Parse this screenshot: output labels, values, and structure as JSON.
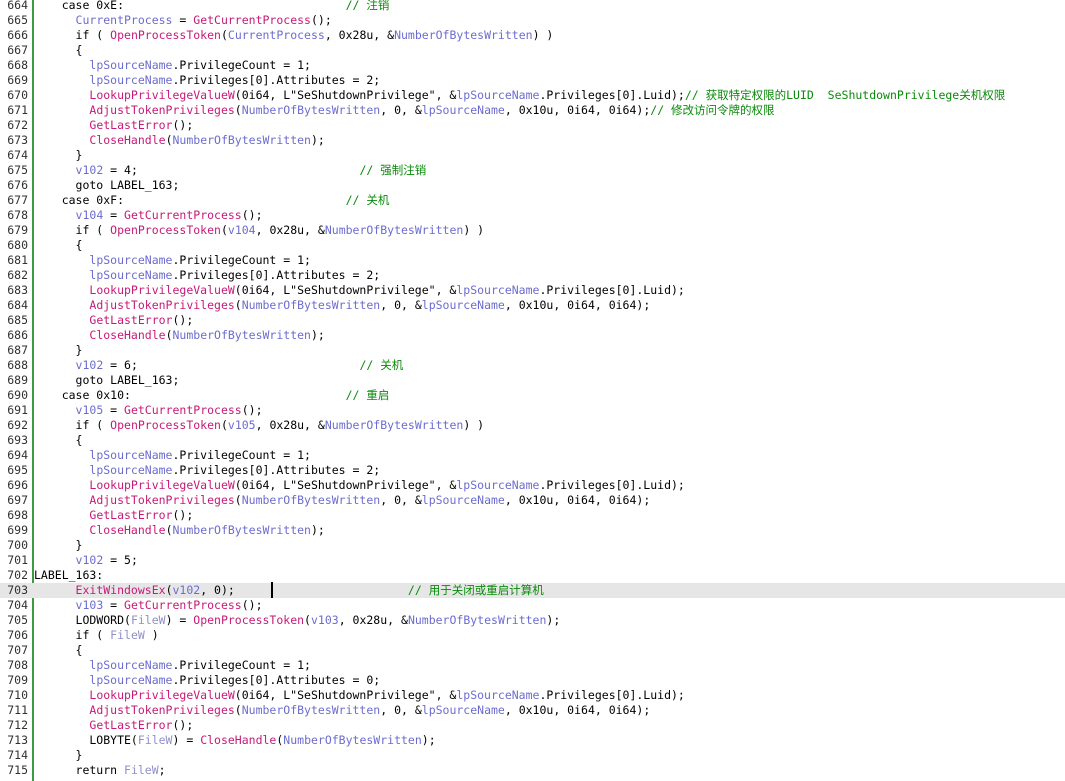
{
  "editor": {
    "current_line": 703,
    "lines": [
      {
        "no": "664",
        "segs": [
          [
            "    case 0xE:                                ",
            ""
          ],
          [
            "// 注销",
            "cm"
          ]
        ]
      },
      {
        "no": "665",
        "segs": [
          [
            "      ",
            ""
          ],
          [
            "CurrentProcess",
            "lvar"
          ],
          [
            " = ",
            ""
          ],
          [
            "GetCurrentProcess",
            "fn"
          ],
          [
            "();",
            ""
          ]
        ]
      },
      {
        "no": "666",
        "segs": [
          [
            "      if ( ",
            ""
          ],
          [
            "OpenProcessToken",
            "fn"
          ],
          [
            "(",
            ""
          ],
          [
            "CurrentProcess",
            "lvar"
          ],
          [
            ", 0x28u, &",
            ""
          ],
          [
            "NumberOfBytesWritten",
            "lvar"
          ],
          [
            ") )",
            ""
          ]
        ]
      },
      {
        "no": "667",
        "segs": [
          [
            "      {",
            ""
          ]
        ]
      },
      {
        "no": "668",
        "segs": [
          [
            "        ",
            ""
          ],
          [
            "lpSourceName",
            "lvar"
          ],
          [
            ".PrivilegeCount = 1;",
            ""
          ]
        ]
      },
      {
        "no": "669",
        "segs": [
          [
            "        ",
            ""
          ],
          [
            "lpSourceName",
            "lvar"
          ],
          [
            ".Privileges[0].Attributes = 2;",
            ""
          ]
        ]
      },
      {
        "no": "670",
        "segs": [
          [
            "        ",
            ""
          ],
          [
            "LookupPrivilegeValueW",
            "fn"
          ],
          [
            "(0i64, L\"SeShutdownPrivilege\", &",
            ""
          ],
          [
            "lpSourceName",
            "lvar"
          ],
          [
            ".Privileges[0].Luid);",
            ""
          ],
          [
            "// 获取特定权限的LUID  SeShutdownPrivilege关机权限",
            "cm"
          ]
        ]
      },
      {
        "no": "671",
        "segs": [
          [
            "        ",
            ""
          ],
          [
            "AdjustTokenPrivileges",
            "fn"
          ],
          [
            "(",
            ""
          ],
          [
            "NumberOfBytesWritten",
            "lvar"
          ],
          [
            ", 0, &",
            ""
          ],
          [
            "lpSourceName",
            "lvar"
          ],
          [
            ", 0x10u, 0i64, 0i64);",
            ""
          ],
          [
            "// 修改访问令牌的权限",
            "cm"
          ]
        ]
      },
      {
        "no": "672",
        "segs": [
          [
            "        ",
            ""
          ],
          [
            "GetLastError",
            "fn"
          ],
          [
            "();",
            ""
          ]
        ]
      },
      {
        "no": "673",
        "segs": [
          [
            "        ",
            ""
          ],
          [
            "CloseHandle",
            "fn"
          ],
          [
            "(",
            ""
          ],
          [
            "NumberOfBytesWritten",
            "lvar"
          ],
          [
            ");",
            ""
          ]
        ]
      },
      {
        "no": "674",
        "segs": [
          [
            "      }",
            ""
          ]
        ]
      },
      {
        "no": "675",
        "segs": [
          [
            "      ",
            ""
          ],
          [
            "v102",
            "lvar"
          ],
          [
            " = 4;                                ",
            ""
          ],
          [
            "// 强制注销",
            "cm"
          ]
        ]
      },
      {
        "no": "676",
        "segs": [
          [
            "      goto LABEL_163;",
            ""
          ]
        ]
      },
      {
        "no": "677",
        "segs": [
          [
            "    case 0xF:                                ",
            ""
          ],
          [
            "// 关机",
            "cm"
          ]
        ]
      },
      {
        "no": "678",
        "segs": [
          [
            "      ",
            ""
          ],
          [
            "v104",
            "lvar"
          ],
          [
            " = ",
            ""
          ],
          [
            "GetCurrentProcess",
            "fn"
          ],
          [
            "();",
            ""
          ]
        ]
      },
      {
        "no": "679",
        "segs": [
          [
            "      if ( ",
            ""
          ],
          [
            "OpenProcessToken",
            "fn"
          ],
          [
            "(",
            ""
          ],
          [
            "v104",
            "lvar"
          ],
          [
            ", 0x28u, &",
            ""
          ],
          [
            "NumberOfBytesWritten",
            "lvar"
          ],
          [
            ") )",
            ""
          ]
        ]
      },
      {
        "no": "680",
        "segs": [
          [
            "      {",
            ""
          ]
        ]
      },
      {
        "no": "681",
        "segs": [
          [
            "        ",
            ""
          ],
          [
            "lpSourceName",
            "lvar"
          ],
          [
            ".PrivilegeCount = 1;",
            ""
          ]
        ]
      },
      {
        "no": "682",
        "segs": [
          [
            "        ",
            ""
          ],
          [
            "lpSourceName",
            "lvar"
          ],
          [
            ".Privileges[0].Attributes = 2;",
            ""
          ]
        ]
      },
      {
        "no": "683",
        "segs": [
          [
            "        ",
            ""
          ],
          [
            "LookupPrivilegeValueW",
            "fn"
          ],
          [
            "(0i64, L\"SeShutdownPrivilege\", &",
            ""
          ],
          [
            "lpSourceName",
            "lvar"
          ],
          [
            ".Privileges[0].Luid);",
            ""
          ]
        ]
      },
      {
        "no": "684",
        "segs": [
          [
            "        ",
            ""
          ],
          [
            "AdjustTokenPrivileges",
            "fn"
          ],
          [
            "(",
            ""
          ],
          [
            "NumberOfBytesWritten",
            "lvar"
          ],
          [
            ", 0, &",
            ""
          ],
          [
            "lpSourceName",
            "lvar"
          ],
          [
            ", 0x10u, 0i64, 0i64);",
            ""
          ]
        ]
      },
      {
        "no": "685",
        "segs": [
          [
            "        ",
            ""
          ],
          [
            "GetLastError",
            "fn"
          ],
          [
            "();",
            ""
          ]
        ]
      },
      {
        "no": "686",
        "segs": [
          [
            "        ",
            ""
          ],
          [
            "CloseHandle",
            "fn"
          ],
          [
            "(",
            ""
          ],
          [
            "NumberOfBytesWritten",
            "lvar"
          ],
          [
            ");",
            ""
          ]
        ]
      },
      {
        "no": "687",
        "segs": [
          [
            "      }",
            ""
          ]
        ]
      },
      {
        "no": "688",
        "segs": [
          [
            "      ",
            ""
          ],
          [
            "v102",
            "lvar"
          ],
          [
            " = 6;                                ",
            ""
          ],
          [
            "// 关机",
            "cm"
          ]
        ]
      },
      {
        "no": "689",
        "segs": [
          [
            "      goto LABEL_163;",
            ""
          ]
        ]
      },
      {
        "no": "690",
        "segs": [
          [
            "    case 0x10:                               ",
            ""
          ],
          [
            "// 重启",
            "cm"
          ]
        ]
      },
      {
        "no": "691",
        "segs": [
          [
            "      ",
            ""
          ],
          [
            "v105",
            "lvar"
          ],
          [
            " = ",
            ""
          ],
          [
            "GetCurrentProcess",
            "fn"
          ],
          [
            "();",
            ""
          ]
        ]
      },
      {
        "no": "692",
        "segs": [
          [
            "      if ( ",
            ""
          ],
          [
            "OpenProcessToken",
            "fn"
          ],
          [
            "(",
            ""
          ],
          [
            "v105",
            "lvar"
          ],
          [
            ", 0x28u, &",
            ""
          ],
          [
            "NumberOfBytesWritten",
            "lvar"
          ],
          [
            ") )",
            ""
          ]
        ]
      },
      {
        "no": "693",
        "segs": [
          [
            "      {",
            ""
          ]
        ]
      },
      {
        "no": "694",
        "segs": [
          [
            "        ",
            ""
          ],
          [
            "lpSourceName",
            "lvar"
          ],
          [
            ".PrivilegeCount = 1;",
            ""
          ]
        ]
      },
      {
        "no": "695",
        "segs": [
          [
            "        ",
            ""
          ],
          [
            "lpSourceName",
            "lvar"
          ],
          [
            ".Privileges[0].Attributes = 2;",
            ""
          ]
        ]
      },
      {
        "no": "696",
        "segs": [
          [
            "        ",
            ""
          ],
          [
            "LookupPrivilegeValueW",
            "fn"
          ],
          [
            "(0i64, L\"SeShutdownPrivilege\", &",
            ""
          ],
          [
            "lpSourceName",
            "lvar"
          ],
          [
            ".Privileges[0].Luid);",
            ""
          ]
        ]
      },
      {
        "no": "697",
        "segs": [
          [
            "        ",
            ""
          ],
          [
            "AdjustTokenPrivileges",
            "fn"
          ],
          [
            "(",
            ""
          ],
          [
            "NumberOfBytesWritten",
            "lvar"
          ],
          [
            ", 0, &",
            ""
          ],
          [
            "lpSourceName",
            "lvar"
          ],
          [
            ", 0x10u, 0i64, 0i64);",
            ""
          ]
        ]
      },
      {
        "no": "698",
        "segs": [
          [
            "        ",
            ""
          ],
          [
            "GetLastError",
            "fn"
          ],
          [
            "();",
            ""
          ]
        ]
      },
      {
        "no": "699",
        "segs": [
          [
            "        ",
            ""
          ],
          [
            "CloseHandle",
            "fn"
          ],
          [
            "(",
            ""
          ],
          [
            "NumberOfBytesWritten",
            "lvar"
          ],
          [
            ");",
            ""
          ]
        ]
      },
      {
        "no": "700",
        "segs": [
          [
            "      }",
            ""
          ]
        ]
      },
      {
        "no": "701",
        "segs": [
          [
            "      ",
            ""
          ],
          [
            "v102",
            "lvar"
          ],
          [
            " = 5;",
            ""
          ]
        ]
      },
      {
        "no": "702",
        "segs": [
          [
            "LABEL_163:",
            ""
          ]
        ]
      },
      {
        "no": "703",
        "segs": [
          [
            "      ",
            ""
          ],
          [
            "ExitWindowsEx",
            "fn"
          ],
          [
            "(",
            ""
          ],
          [
            "v102",
            "lvar"
          ],
          [
            ", 0);                         ",
            ""
          ],
          [
            "// 用于关闭或重启计算机",
            "cm"
          ]
        ]
      },
      {
        "no": "704",
        "segs": [
          [
            "      ",
            ""
          ],
          [
            "v103",
            "lvar"
          ],
          [
            " = ",
            ""
          ],
          [
            "GetCurrentProcess",
            "fn"
          ],
          [
            "();",
            ""
          ]
        ]
      },
      {
        "no": "705",
        "segs": [
          [
            "      LODWORD(",
            ""
          ],
          [
            "FileW",
            "gvar"
          ],
          [
            ") = ",
            ""
          ],
          [
            "OpenProcessToken",
            "fn"
          ],
          [
            "(",
            ""
          ],
          [
            "v103",
            "lvar"
          ],
          [
            ", 0x28u, &",
            ""
          ],
          [
            "NumberOfBytesWritten",
            "lvar"
          ],
          [
            ");",
            ""
          ]
        ]
      },
      {
        "no": "706",
        "segs": [
          [
            "      if ( ",
            ""
          ],
          [
            "FileW",
            "gvar"
          ],
          [
            " )",
            ""
          ]
        ]
      },
      {
        "no": "707",
        "segs": [
          [
            "      {",
            ""
          ]
        ]
      },
      {
        "no": "708",
        "segs": [
          [
            "        ",
            ""
          ],
          [
            "lpSourceName",
            "lvar"
          ],
          [
            ".PrivilegeCount = 1;",
            ""
          ]
        ]
      },
      {
        "no": "709",
        "segs": [
          [
            "        ",
            ""
          ],
          [
            "lpSourceName",
            "lvar"
          ],
          [
            ".Privileges[0].Attributes = 0;",
            ""
          ]
        ]
      },
      {
        "no": "710",
        "segs": [
          [
            "        ",
            ""
          ],
          [
            "LookupPrivilegeValueW",
            "fn"
          ],
          [
            "(0i64, L\"SeShutdownPrivilege\", &",
            ""
          ],
          [
            "lpSourceName",
            "lvar"
          ],
          [
            ".Privileges[0].Luid);",
            ""
          ]
        ]
      },
      {
        "no": "711",
        "segs": [
          [
            "        ",
            ""
          ],
          [
            "AdjustTokenPrivileges",
            "fn"
          ],
          [
            "(",
            ""
          ],
          [
            "NumberOfBytesWritten",
            "lvar"
          ],
          [
            ", 0, &",
            ""
          ],
          [
            "lpSourceName",
            "lvar"
          ],
          [
            ", 0x10u, 0i64, 0i64);",
            ""
          ]
        ]
      },
      {
        "no": "712",
        "segs": [
          [
            "        ",
            ""
          ],
          [
            "GetLastError",
            "fn"
          ],
          [
            "();",
            ""
          ]
        ]
      },
      {
        "no": "713",
        "segs": [
          [
            "        LOBYTE(",
            ""
          ],
          [
            "FileW",
            "gvar"
          ],
          [
            ") = ",
            ""
          ],
          [
            "CloseHandle",
            "fn"
          ],
          [
            "(",
            ""
          ],
          [
            "NumberOfBytesWritten",
            "lvar"
          ],
          [
            ");",
            ""
          ]
        ]
      },
      {
        "no": "714",
        "segs": [
          [
            "      }",
            ""
          ]
        ]
      },
      {
        "no": "715",
        "segs": [
          [
            "      return ",
            ""
          ],
          [
            "FileW",
            "gvar"
          ],
          [
            ";",
            ""
          ]
        ]
      }
    ]
  },
  "colors": {
    "background": "#ffffff",
    "text": "#000000",
    "local_variable": "#6c6cd0",
    "function_name": "#c61a78",
    "global_name": "#9090c8",
    "comment": "#0a8a0a",
    "gutter_bar": "#3f9a3f",
    "current_line_highlight": "#e6e6e6"
  }
}
